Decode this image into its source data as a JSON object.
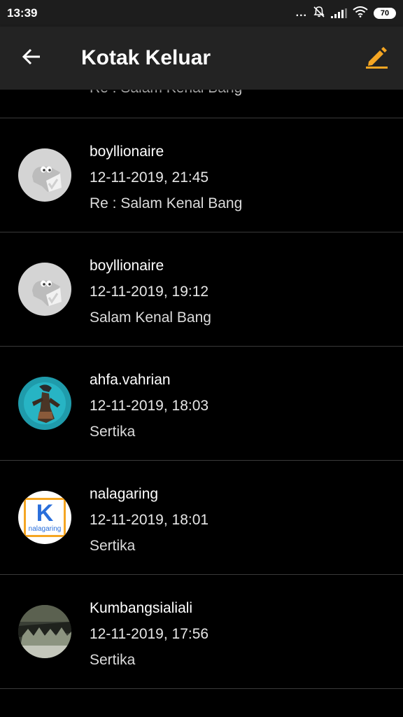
{
  "status": {
    "time": "13:39",
    "dots": "...",
    "battery": "70"
  },
  "appbar": {
    "title": "Kotak Keluar"
  },
  "partial_item": {
    "subject": "Re : Salam Kenal Bang"
  },
  "messages": [
    {
      "name": "boyllionaire",
      "datetime": "12-11-2019, 21:45",
      "subject": "Re : Salam Kenal Bang"
    },
    {
      "name": "boyllionaire",
      "datetime": "12-11-2019, 19:12",
      "subject": "Salam Kenal Bang"
    },
    {
      "name": "ahfa.vahrian",
      "datetime": "12-11-2019, 18:03",
      "subject": "Sertika"
    },
    {
      "name": "nalagaring",
      "datetime": "12-11-2019, 18:01",
      "subject": "Sertika"
    },
    {
      "name": "Kumbangsialiali",
      "datetime": "12-11-2019, 17:56",
      "subject": "Sertika"
    }
  ],
  "avatars": {
    "nalagaring_letter": "K",
    "nalagaring_caption": "nalagaring"
  },
  "colors": {
    "accent": "#f5a623",
    "appbar": "#232323",
    "background": "#000000"
  }
}
